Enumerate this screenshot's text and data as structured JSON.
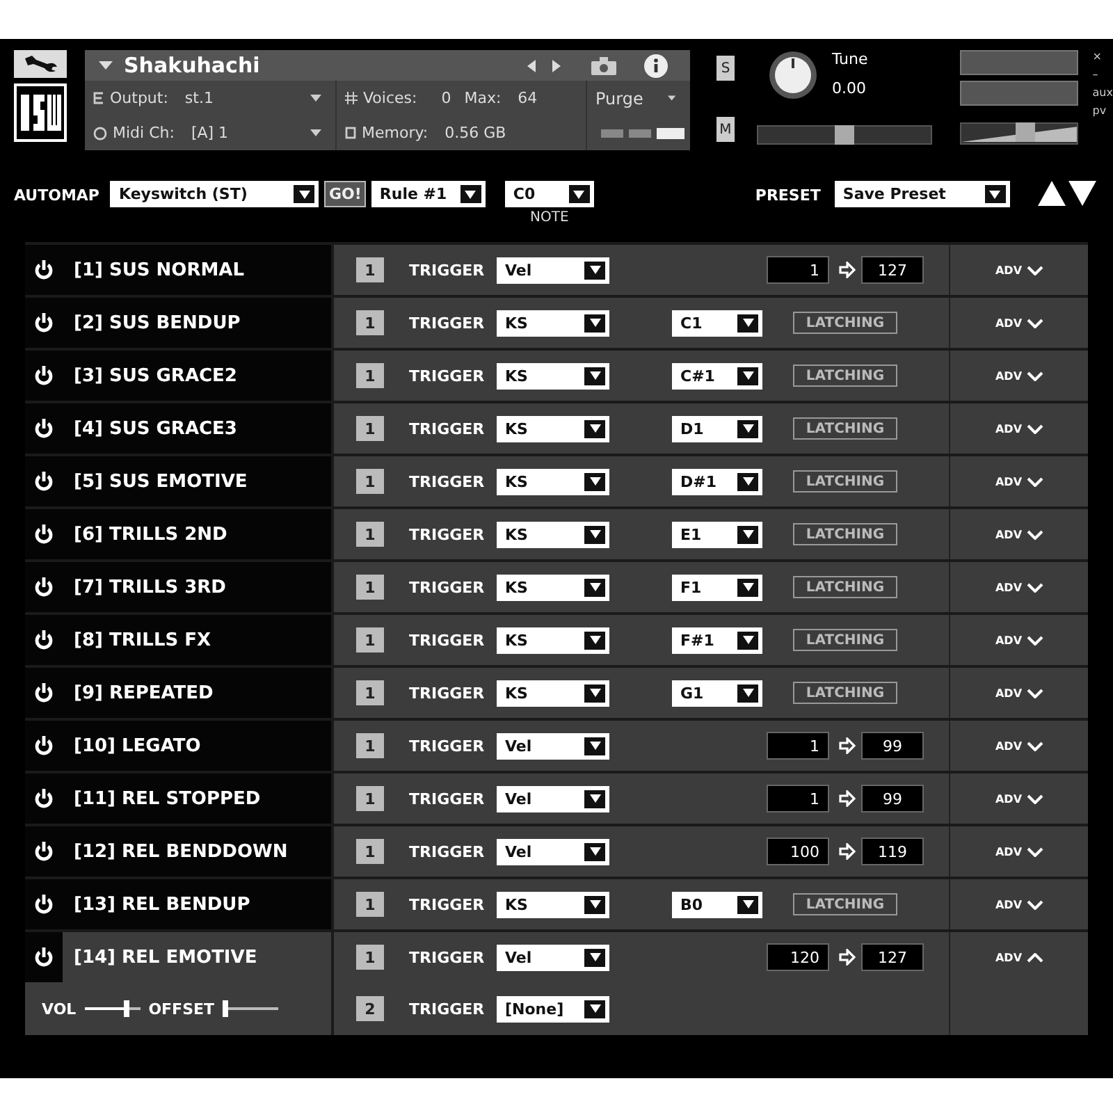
{
  "instrument": {
    "name": "Shakuhachi",
    "output_label": "Output:",
    "output": "st.1",
    "midi_label": "Midi Ch:",
    "midi": "[A] 1",
    "voices_label": "Voices:",
    "voices": "0",
    "max_label": "Max:",
    "max": "64",
    "memory_label": "Memory:",
    "memory": "0.56 GB",
    "purge": "Purge",
    "solo": "S",
    "mute": "M",
    "tune_label": "Tune",
    "tune_value": "0.00",
    "pan": {
      "level": 0.5
    },
    "volume": {
      "level": 0.55
    },
    "window_controls": [
      "×",
      "–",
      "aux",
      "pv"
    ]
  },
  "automap": {
    "label": "AUTOMAP",
    "mode": "Keyswitch (ST)",
    "go": "GO!",
    "rule": "Rule #1",
    "note": "C0",
    "note_label": "NOTE",
    "preset_label": "PRESET",
    "preset": "Save Preset"
  },
  "articulations": [
    {
      "name": "[1] SUS NORMAL",
      "expanded": false,
      "adv": "ADV",
      "triggers": [
        {
          "index": "1",
          "label": "TRIGGER",
          "kind": "vel",
          "type": "Vel",
          "from": "1",
          "to": "127"
        }
      ]
    },
    {
      "name": "[2] SUS BENDUP",
      "expanded": false,
      "adv": "ADV",
      "triggers": [
        {
          "index": "1",
          "label": "TRIGGER",
          "kind": "ks",
          "type": "KS",
          "key": "C1",
          "latching": "LATCHING"
        }
      ]
    },
    {
      "name": "[3] SUS GRACE2",
      "expanded": false,
      "adv": "ADV",
      "triggers": [
        {
          "index": "1",
          "label": "TRIGGER",
          "kind": "ks",
          "type": "KS",
          "key": "C#1",
          "latching": "LATCHING"
        }
      ]
    },
    {
      "name": "[4] SUS GRACE3",
      "expanded": false,
      "adv": "ADV",
      "triggers": [
        {
          "index": "1",
          "label": "TRIGGER",
          "kind": "ks",
          "type": "KS",
          "key": "D1",
          "latching": "LATCHING"
        }
      ]
    },
    {
      "name": "[5] SUS EMOTIVE",
      "expanded": false,
      "adv": "ADV",
      "triggers": [
        {
          "index": "1",
          "label": "TRIGGER",
          "kind": "ks",
          "type": "KS",
          "key": "D#1",
          "latching": "LATCHING"
        }
      ]
    },
    {
      "name": "[6] TRILLS 2ND",
      "expanded": false,
      "adv": "ADV",
      "triggers": [
        {
          "index": "1",
          "label": "TRIGGER",
          "kind": "ks",
          "type": "KS",
          "key": "E1",
          "latching": "LATCHING"
        }
      ]
    },
    {
      "name": "[7] TRILLS 3RD",
      "expanded": false,
      "adv": "ADV",
      "triggers": [
        {
          "index": "1",
          "label": "TRIGGER",
          "kind": "ks",
          "type": "KS",
          "key": "F1",
          "latching": "LATCHING"
        }
      ]
    },
    {
      "name": "[8] TRILLS FX",
      "expanded": false,
      "adv": "ADV",
      "triggers": [
        {
          "index": "1",
          "label": "TRIGGER",
          "kind": "ks",
          "type": "KS",
          "key": "F#1",
          "latching": "LATCHING"
        }
      ]
    },
    {
      "name": "[9] REPEATED",
      "expanded": false,
      "adv": "ADV",
      "triggers": [
        {
          "index": "1",
          "label": "TRIGGER",
          "kind": "ks",
          "type": "KS",
          "key": "G1",
          "latching": "LATCHING"
        }
      ]
    },
    {
      "name": "[10] LEGATO",
      "expanded": false,
      "adv": "ADV",
      "triggers": [
        {
          "index": "1",
          "label": "TRIGGER",
          "kind": "vel",
          "type": "Vel",
          "from": "1",
          "to": "99"
        }
      ]
    },
    {
      "name": "[11] REL STOPPED",
      "expanded": false,
      "adv": "ADV",
      "triggers": [
        {
          "index": "1",
          "label": "TRIGGER",
          "kind": "vel",
          "type": "Vel",
          "from": "1",
          "to": "99"
        }
      ]
    },
    {
      "name": "[12] REL BENDDOWN",
      "expanded": false,
      "adv": "ADV",
      "triggers": [
        {
          "index": "1",
          "label": "TRIGGER",
          "kind": "vel",
          "type": "Vel",
          "from": "100",
          "to": "119"
        }
      ]
    },
    {
      "name": "[13] REL BENDUP",
      "expanded": false,
      "adv": "ADV",
      "triggers": [
        {
          "index": "1",
          "label": "TRIGGER",
          "kind": "ks",
          "type": "KS",
          "key": "B0",
          "latching": "LATCHING"
        }
      ]
    },
    {
      "name": "[14] REL EMOTIVE",
      "expanded": true,
      "adv": "ADV",
      "vol_label": "VOL",
      "vol": {
        "level": 0.75
      },
      "offset_label": "OFFSET",
      "offset": {
        "level": 0.05
      },
      "triggers": [
        {
          "index": "1",
          "label": "TRIGGER",
          "kind": "vel",
          "type": "Vel",
          "from": "120",
          "to": "127"
        },
        {
          "index": "2",
          "label": "TRIGGER",
          "kind": "none",
          "type": "[None]"
        }
      ]
    }
  ]
}
